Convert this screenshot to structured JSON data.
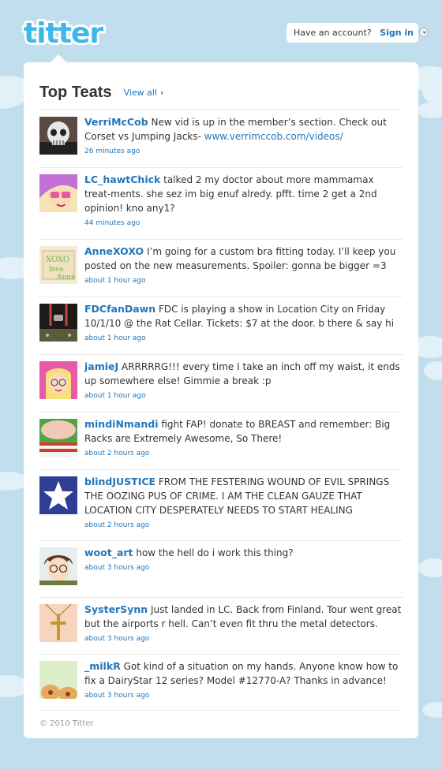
{
  "header": {
    "logo": "titter",
    "account_prompt": "Have an account?",
    "sign_in": "Sign in"
  },
  "main": {
    "title": "Top Teats",
    "view_all": "View all"
  },
  "tweets": [
    {
      "user": "VerriMcCob",
      "text": "New vid is up in the member’s section. Check out Corset vs Jumping Jacks- ",
      "link": "www.verrimccob.com/videos/",
      "time": "26 minutes ago",
      "avatar": "skull-avatar"
    },
    {
      "user": "LC_hawtChick",
      "text": "talked 2 my doctor about more mammamax treat-ments. she sez im big enuf alredy. pfft. time 2 get a 2nd opinion! kno any1?",
      "time": "44 minutes ago",
      "avatar": "pink-hair-avatar"
    },
    {
      "user": "AnneXOXO",
      "text": "I’m going for a custom bra fitting today. I’ll keep you posted on the new measurements. Spoiler: gonna be bigger =3",
      "time": "about 1 hour ago",
      "avatar": "xoxo-note-avatar"
    },
    {
      "user": "FDCfanDawn",
      "text": "FDC is playing a show in Location City on Friday 10/1/10 @ the Rat Cellar. Tickets: $7 at the door. b there & say hi",
      "time": "about 1 hour ago",
      "avatar": "leather-jacket-avatar"
    },
    {
      "user": "jamieJ",
      "text": "ARRRRRG!!! every time I take an inch off my waist, it ends up somewhere else! Gimmie a break :p",
      "time": "about 1 hour ago",
      "avatar": "blonde-girl-avatar"
    },
    {
      "user": "mindiNmandi",
      "text": "fight FAP! donate to BREAST and remember: Big Racks are Extremely Awesome, So There!",
      "time": "about 2 hours ago",
      "avatar": "striped-avatar"
    },
    {
      "user": "blindJUSTICE",
      "text": "FROM THE FESTERING WOUND OF EVIL SPRINGS THE OOZING PUS OF CRIME. I AM THE CLEAN GAUZE THAT LOCATION CITY DESPERATELY NEEDS TO START HEALING",
      "time": "about 2 hours ago",
      "avatar": "star-avatar"
    },
    {
      "user": "woot_art",
      "text": "how the hell do i work this thing?",
      "time": "about 3 hours ago",
      "avatar": "glasses-boy-avatar"
    },
    {
      "user": "SysterSynn",
      "text": "Just landed in LC. Back from Finland. Tour went great but the airports r hell. Can’t even fit thru the metal detectors.",
      "time": "about 3 hours ago",
      "avatar": "cross-necklace-avatar"
    },
    {
      "user": "_milkR",
      "text": "Got kind of a situation on my hands. Anyone know how to fix a DairyStar 12 series? Model #12770-A? Thanks in advance!",
      "time": "about 3 hours ago",
      "avatar": "cow-avatar"
    }
  ],
  "footer": {
    "copyright": "© 2010 Titter"
  },
  "colors": {
    "background": "#c0deed",
    "link": "#2276bb",
    "logo": "#3fb8e8"
  }
}
